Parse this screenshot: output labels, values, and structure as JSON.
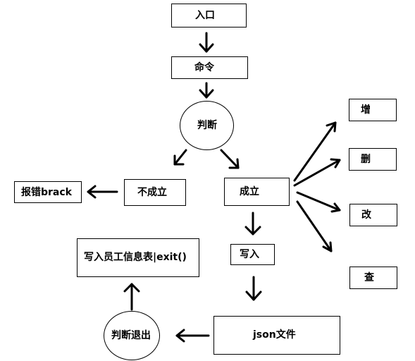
{
  "diagram": {
    "nodes": {
      "entry": "入口",
      "command": "命令",
      "judge": "判断",
      "error": "报错brack",
      "not_valid": "不成立",
      "valid": "成立",
      "add": "增",
      "delete": "删",
      "modify": "改",
      "query": "查",
      "write": "写入",
      "json_file": "json文件",
      "judge_exit": "判断退出",
      "write_table": "写入员工信息表|exit()"
    }
  }
}
